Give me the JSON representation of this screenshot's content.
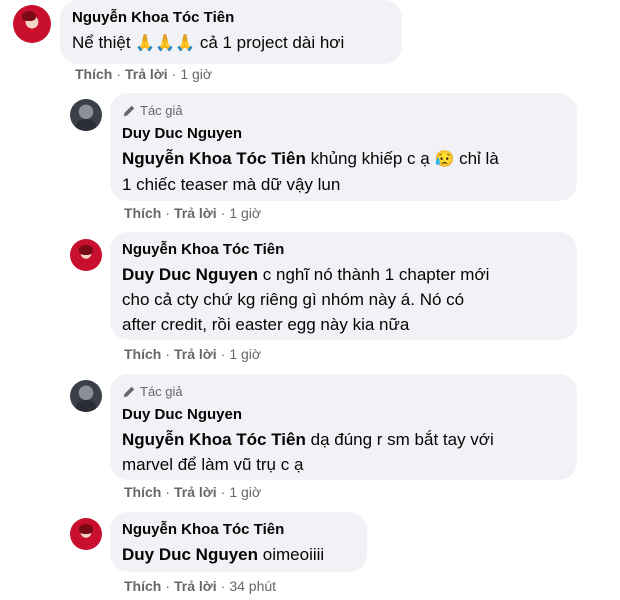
{
  "comments": [
    {
      "author": "Nguyễn Khoa Tóc Tiên",
      "text": "Nể thiệt",
      "emoji": "🙏🙏🙏",
      "text_after": "cả 1 project dài hơi",
      "like": "Thích",
      "reply": "Trả lời",
      "time": "1 giờ"
    },
    {
      "badge": "Tác giả",
      "author": "Duy Duc Nguyen",
      "mention": "Nguyễn Khoa Tóc Tiên",
      "text": "khủng khiếp c ạ",
      "emoji": "😥",
      "text_line2": "chỉ là",
      "text_line3": "1 chiếc teaser mà dữ vậy lun",
      "like": "Thích",
      "reply": "Trả lời",
      "time": "1 giờ"
    },
    {
      "author": "Nguyễn Khoa Tóc Tiên",
      "mention": "Duy Duc Nguyen",
      "text_line1": "c nghĩ nó thành 1 chapter mới",
      "text_line2": "cho cả cty chứ kg riêng gì nhóm này á. Nó có",
      "text_line3": "after credit, rồi easter egg này kia nữa",
      "like": "Thích",
      "reply": "Trả lời",
      "time": "1 giờ"
    },
    {
      "badge": "Tác giả",
      "author": "Duy Duc Nguyen",
      "mention": "Nguyễn Khoa Tóc Tiên",
      "text_line1": "dạ đúng r sm bắt tay với",
      "text_line2": "marvel để làm vũ trụ c ạ",
      "like": "Thích",
      "reply": "Trả lời",
      "time": "1 giờ"
    },
    {
      "author": "Nguyễn Khoa Tóc Tiên",
      "mention": "Duy Duc Nguyen",
      "text_line1": "oimeoiiii",
      "like": "Thích",
      "reply": "Trả lời",
      "time": "34 phút"
    }
  ],
  "separator": "·",
  "colors": {
    "bubble": "#f0f2f5",
    "meta": "#65676b",
    "text": "#050505"
  }
}
